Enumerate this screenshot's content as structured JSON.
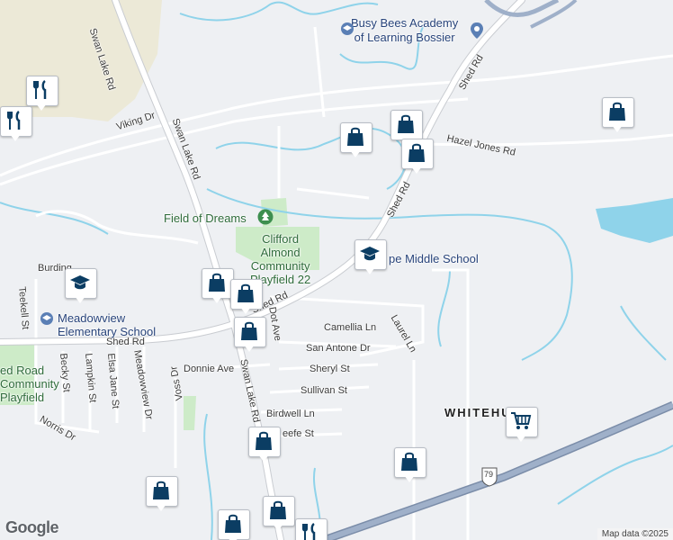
{
  "map": {
    "colors": {
      "background": "#eef0f3",
      "water": "#8fd3ea",
      "major_road": "#ffffff",
      "road_outline": "#c9ccd1",
      "highway": "#8fa2c1",
      "park": "#cdebc8",
      "field": "#ece9d7",
      "pin_icon": "#0b3d63"
    },
    "roads": {
      "swan_lake_top": "Swan Lake Rd",
      "swan_lake_mid": "Swan Lake Rd",
      "swan_lake_bottom": "Swan Lake Rd",
      "shed_top": "Shed Rd",
      "shed_mid": "Shed Rd",
      "shed_left": "Shed Rd",
      "shed_center": "Shed Rd",
      "viking": "Viking Dr",
      "hazel_jones": "Hazel Jones Rd",
      "dot": "Dot Ave",
      "camellia": "Camellia Ln",
      "laurel": "Laurel Ln",
      "san_antone": "San Antone Dr",
      "sheryl": "Sheryl St",
      "sullivan": "Sullivan St",
      "birdwell": "Birdwell Ln",
      "keefe": "eefe St",
      "donnie": "Donnie Ave",
      "teekell": "Teekell St",
      "becky": "Becky St",
      "lampkin": "Lampkin St",
      "elsa_jane": "Elsa Jane St",
      "meadowview": "Meadowview Dr",
      "voss": "Voss Dr",
      "norris": "Norris Dr",
      "burding": "Burding",
      "hwy": "79"
    },
    "places": {
      "busy_bees": "Busy Bees Academy\nof Learning Bossier",
      "field_of_dreams": "Field of Dreams",
      "clifford_almond": "Clifford\nAlmond\nCommunity\nPlayfield 22",
      "greenacres": "pe Middle School",
      "meadowview_school": "Meadowview\nElementary School",
      "shed_road_playfield": "ed Road\nCommunity\nPlayfield",
      "whitehu": "WHITEHU"
    },
    "attribution": "Map data ©2025",
    "logo": "Google"
  }
}
